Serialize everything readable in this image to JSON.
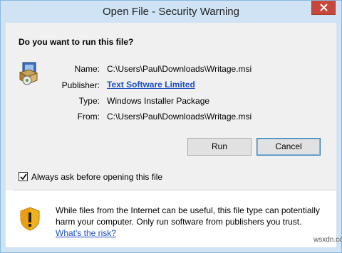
{
  "window": {
    "title": "Open File - Security Warning",
    "close_icon": "close-icon"
  },
  "dialog": {
    "heading": "Do you want to run this file?",
    "file_icon": "installer-package-icon",
    "fields": {
      "name_label": "Name:",
      "name_value": "C:\\Users\\Paul\\Downloads\\Writage.msi",
      "publisher_label": "Publisher:",
      "publisher_value": "Text Software Limited",
      "type_label": "Type:",
      "type_value": "Windows Installer Package",
      "from_label": "From:",
      "from_value": "C:\\Users\\Paul\\Downloads\\Writage.msi"
    },
    "buttons": {
      "run": "Run",
      "cancel": "Cancel"
    },
    "checkbox": {
      "label": "Always ask before opening this file",
      "checked": true
    }
  },
  "footer": {
    "icon": "shield-warning-icon",
    "text": "While files from the Internet can be useful, this file type can potentially harm your computer. Only run software from publishers you trust.",
    "link": "What's the risk?",
    "watermark": "wsxdn.com"
  }
}
